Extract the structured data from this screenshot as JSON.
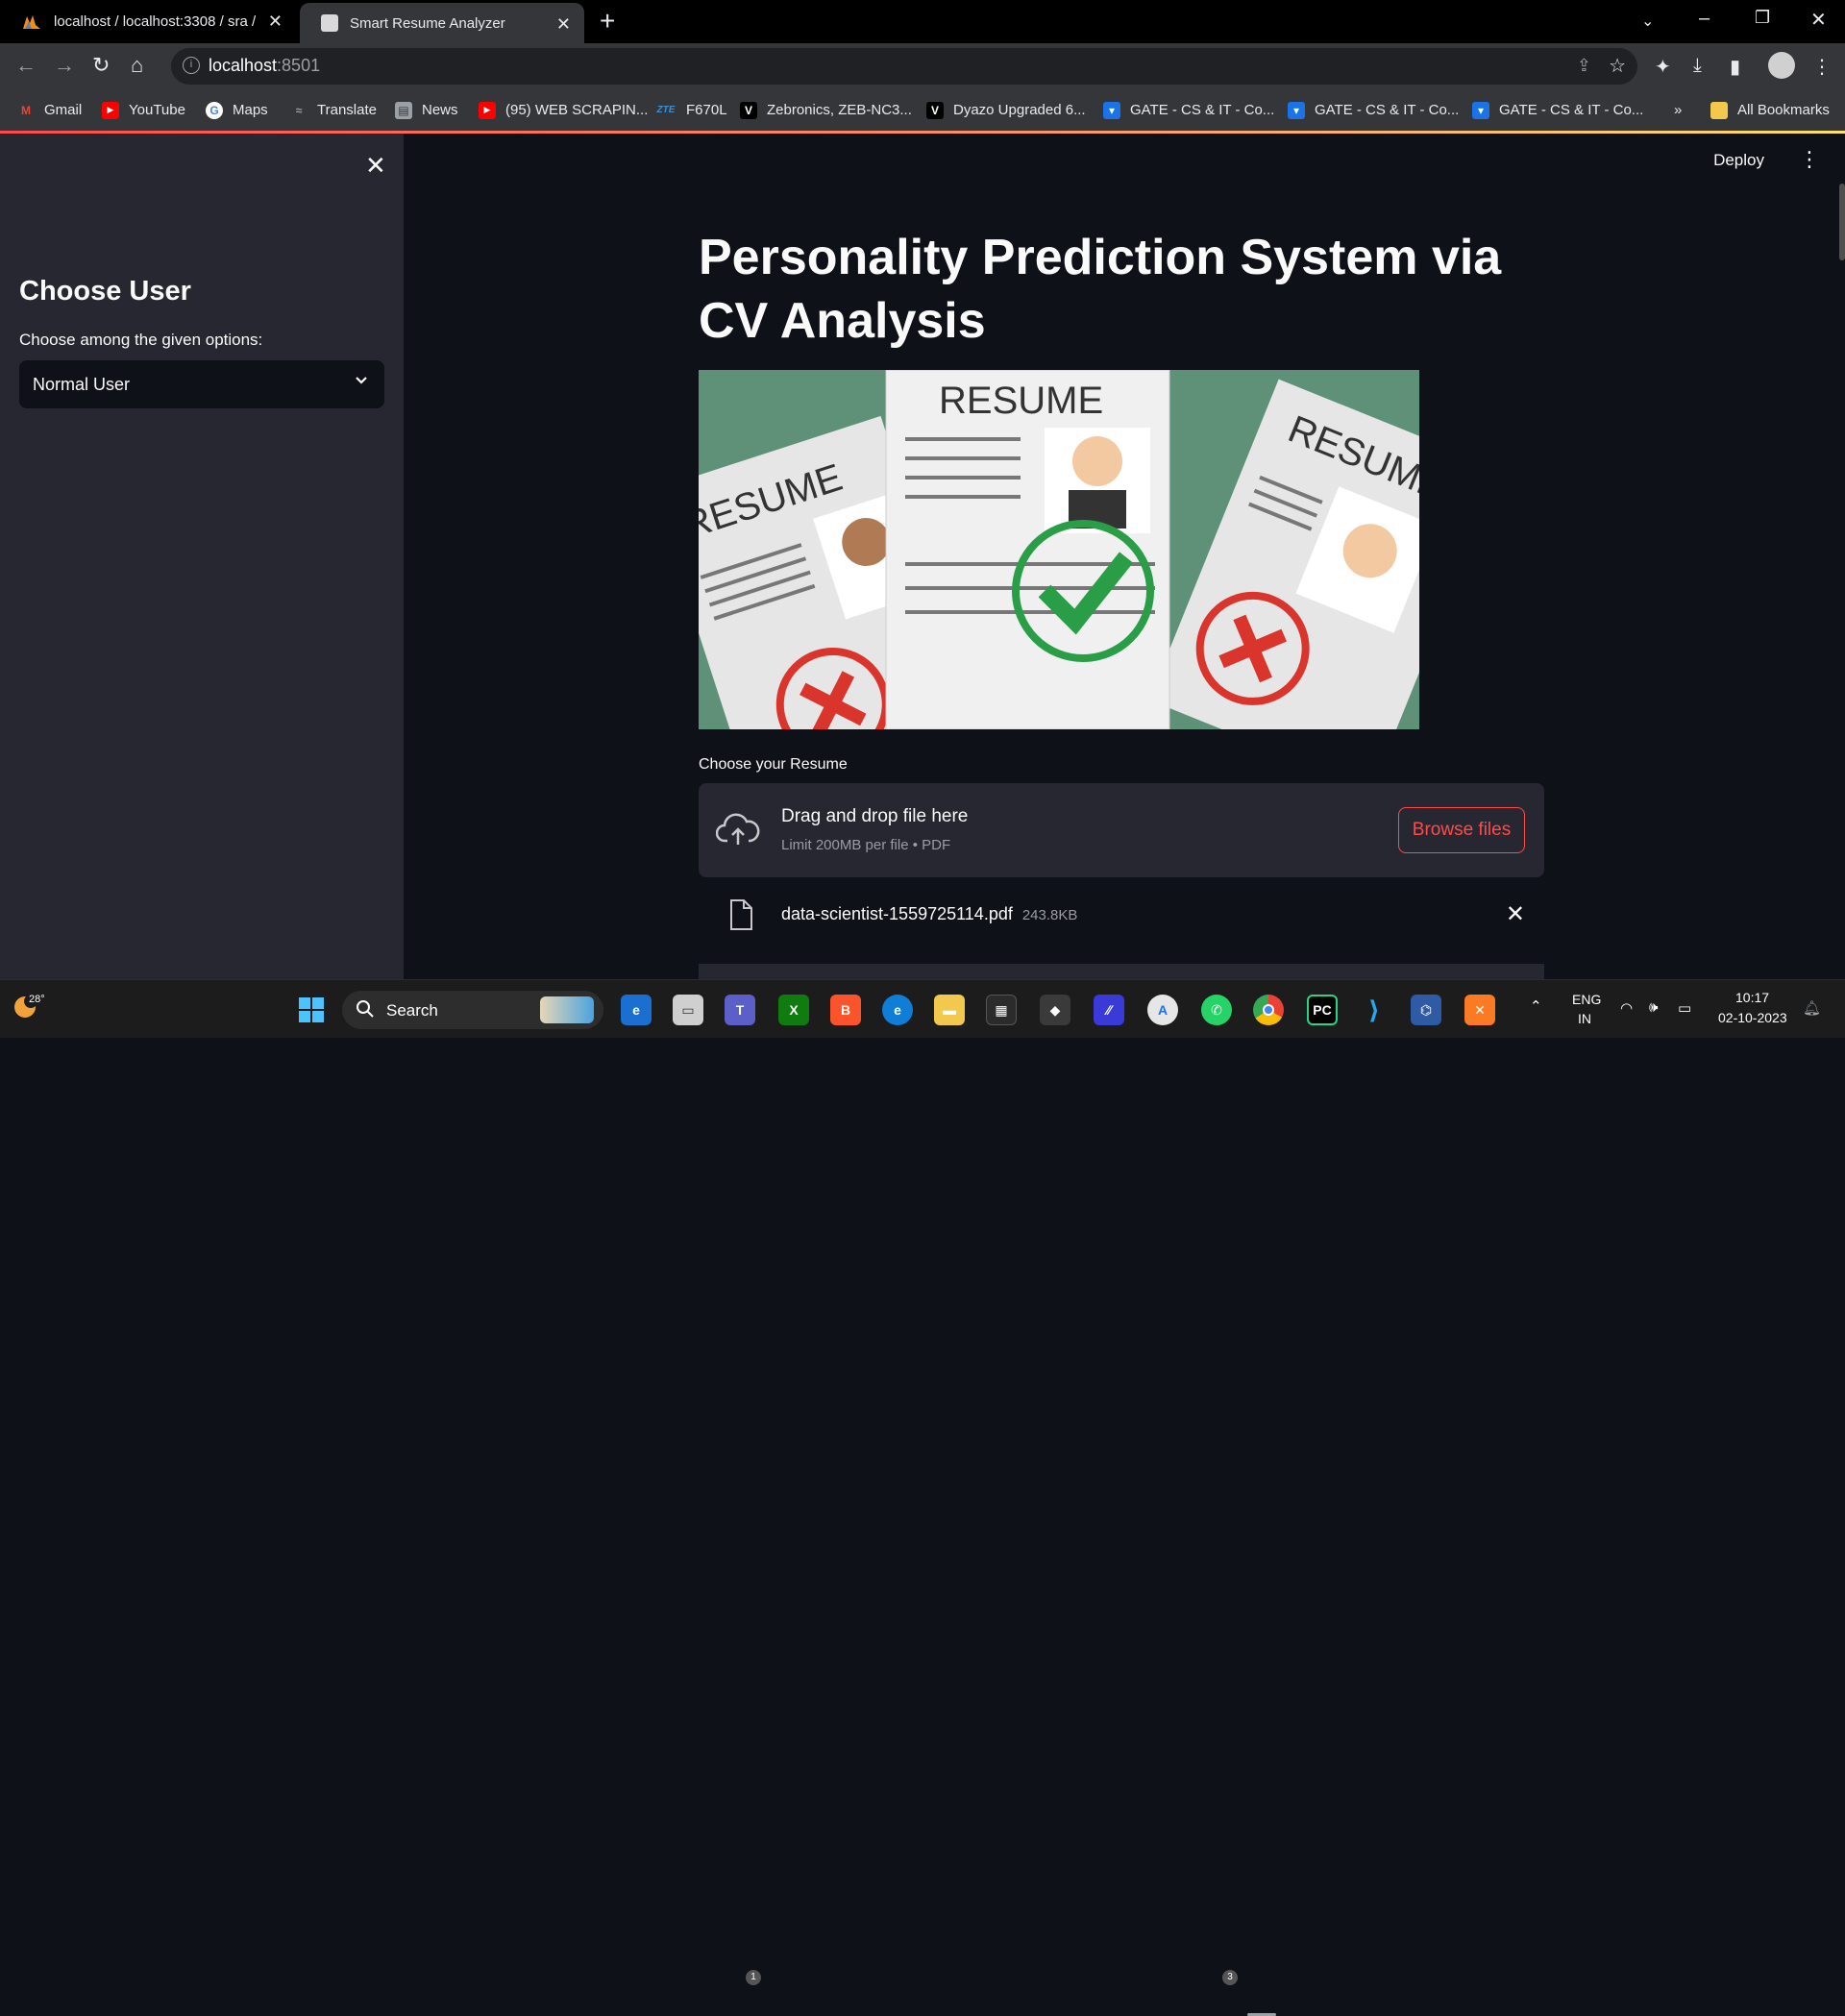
{
  "browser": {
    "tabs": [
      {
        "title": "localhost / localhost:3308 / sra /",
        "active": false
      },
      {
        "title": "Smart Resume Analyzer",
        "active": true
      }
    ],
    "url_host": "localhost",
    "url_port": ":8501",
    "bookmarks": [
      {
        "label": "Gmail",
        "icon": "gmail-icon",
        "color": "#ea4335"
      },
      {
        "label": "YouTube",
        "icon": "youtube-icon",
        "color": "#ff0000"
      },
      {
        "label": "Maps",
        "icon": "google-icon",
        "color": "#ffffff"
      },
      {
        "label": "Translate",
        "icon": "translate-icon",
        "color": "#9aa0a6"
      },
      {
        "label": "News",
        "icon": "news-icon",
        "color": "#9aa0a6"
      },
      {
        "label": "(95) WEB SCRAPIN...",
        "icon": "youtube-icon",
        "color": "#ff0000"
      },
      {
        "label": "F670L",
        "icon": "zte-icon",
        "color": "#0077c8"
      },
      {
        "label": "Zebronics, ZEB-NC3...",
        "icon": "v-icon",
        "color": "#000000"
      },
      {
        "label": "Dyazo Upgraded 6...",
        "icon": "v-icon",
        "color": "#000000"
      },
      {
        "label": "GATE - CS & IT - Co...",
        "icon": "gate-icon",
        "color": "#1a73e8"
      },
      {
        "label": "GATE - CS & IT - Co...",
        "icon": "gate-icon",
        "color": "#1a73e8"
      },
      {
        "label": "GATE - CS & IT - Co...",
        "icon": "gate-icon",
        "color": "#1a73e8"
      }
    ],
    "more_bookmarks": "»",
    "all_bookmarks": "All Bookmarks"
  },
  "sidebar": {
    "title": "Choose User",
    "select_label": "Choose among the given options:",
    "selected_option": "Normal User"
  },
  "header": {
    "deploy_label": "Deploy"
  },
  "main": {
    "title": "Personality Prediction System via CV Analysis",
    "banner_words": [
      "RESUME",
      "RESUME",
      "RESUME"
    ],
    "uploader": {
      "label": "Choose your Resume",
      "drop_text": "Drag and drop file here",
      "limit_text": "Limit 200MB per file • PDF",
      "browse_label": "Browse files"
    },
    "file": {
      "name": "data-scientist-1559725114.pdf",
      "size": "243.8KB"
    }
  },
  "taskbar": {
    "weather_temp": "28°",
    "search_placeholder": "Search",
    "language_top": "ENG",
    "language_bottom": "IN",
    "time": "10:17",
    "date": "02-10-2023",
    "badges": {
      "teams": "1",
      "whatsapp": "3"
    }
  },
  "colors": {
    "accent": "#ff4b4b",
    "sidebar_bg": "#262730",
    "main_bg": "#0e1117"
  }
}
